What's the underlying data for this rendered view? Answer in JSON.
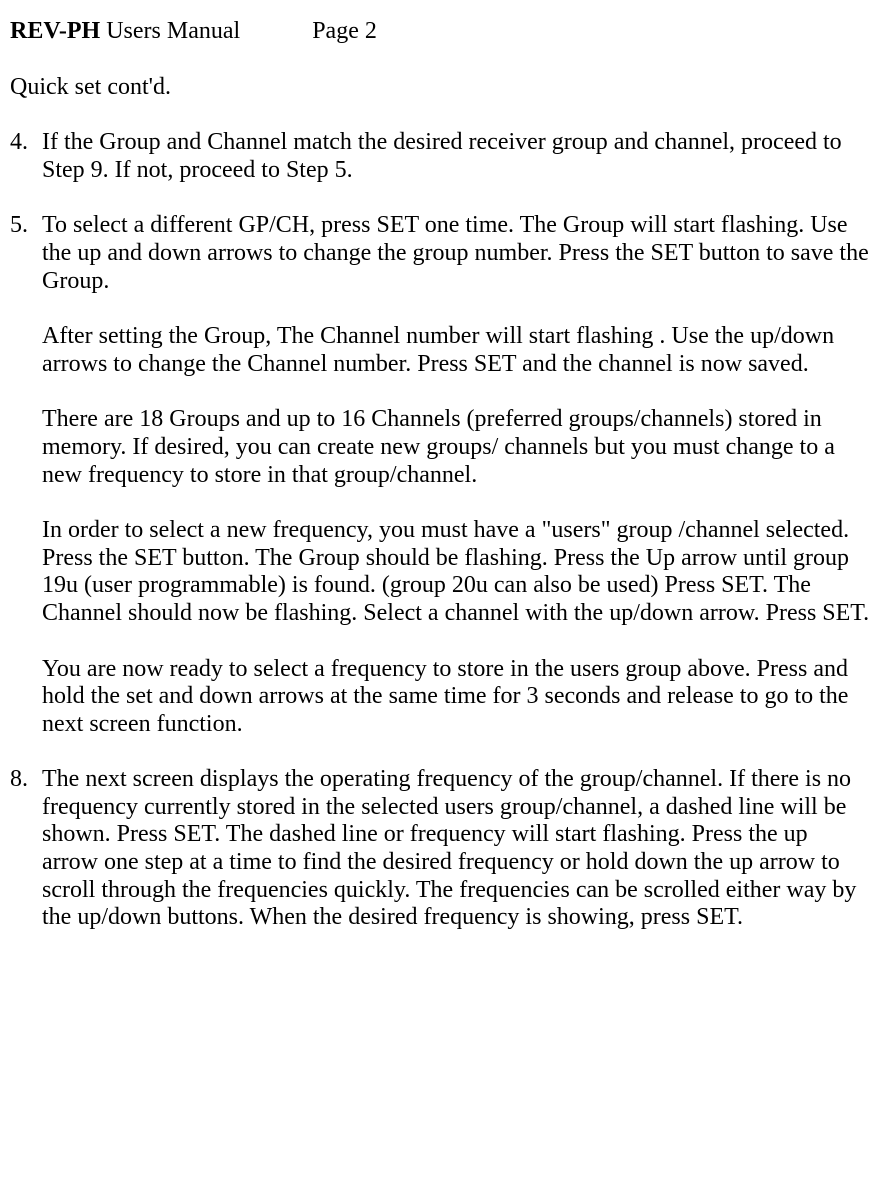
{
  "header": {
    "title_bold": "REV-PH",
    "title_rest": " Users Manual",
    "page_label": "Page 2"
  },
  "section_title": "Quick set cont'd.",
  "item4": {
    "num": "4.",
    "text": "If the Group and Channel match the desired receiver group and channel, proceed to Step 9. If not, proceed to Step 5."
  },
  "item5": {
    "num": "5.",
    "p1": "To select a different GP/CH, press SET one time. The Group will start flashing. Use the up and down arrows to change the group number. Press the SET button to save the Group.",
    "p2": "After setting the Group, The Channel number will start flashing . Use the up/down arrows to change the Channel number. Press SET and the channel is now saved.",
    "p3": "There are 18 Groups and up to 16 Channels (preferred groups/channels) stored in memory. If desired, you can create new groups/ channels but you must change to a new frequency to store in that group/channel.",
    "p4": "In order to select a new frequency, you must have a \"users\" group  /channel selected. Press the SET button. The Group should be flashing. Press the Up arrow until group 19u (user programmable) is found. (group 20u can also be used) Press SET. The Channel should now be flashing. Select a channel with the up/down arrow. Press SET.",
    "p5": "You are now ready to select a frequency to store in the users group above. Press and hold the set and down arrows at the same time for 3  seconds and release to go to the next screen function."
  },
  "item8": {
    "num": "8.",
    "text": "The next screen displays the operating frequency of the group/channel. If there is no frequency currently stored in the selected users group/channel, a dashed line will be shown. Press SET. The dashed line or frequency will start flashing. Press the up arrow one step at a time to find the desired frequency or hold down the up arrow to scroll through the frequencies quickly. The frequencies can be scrolled either way by the up/down buttons. When the desired frequency is showing, press SET."
  }
}
